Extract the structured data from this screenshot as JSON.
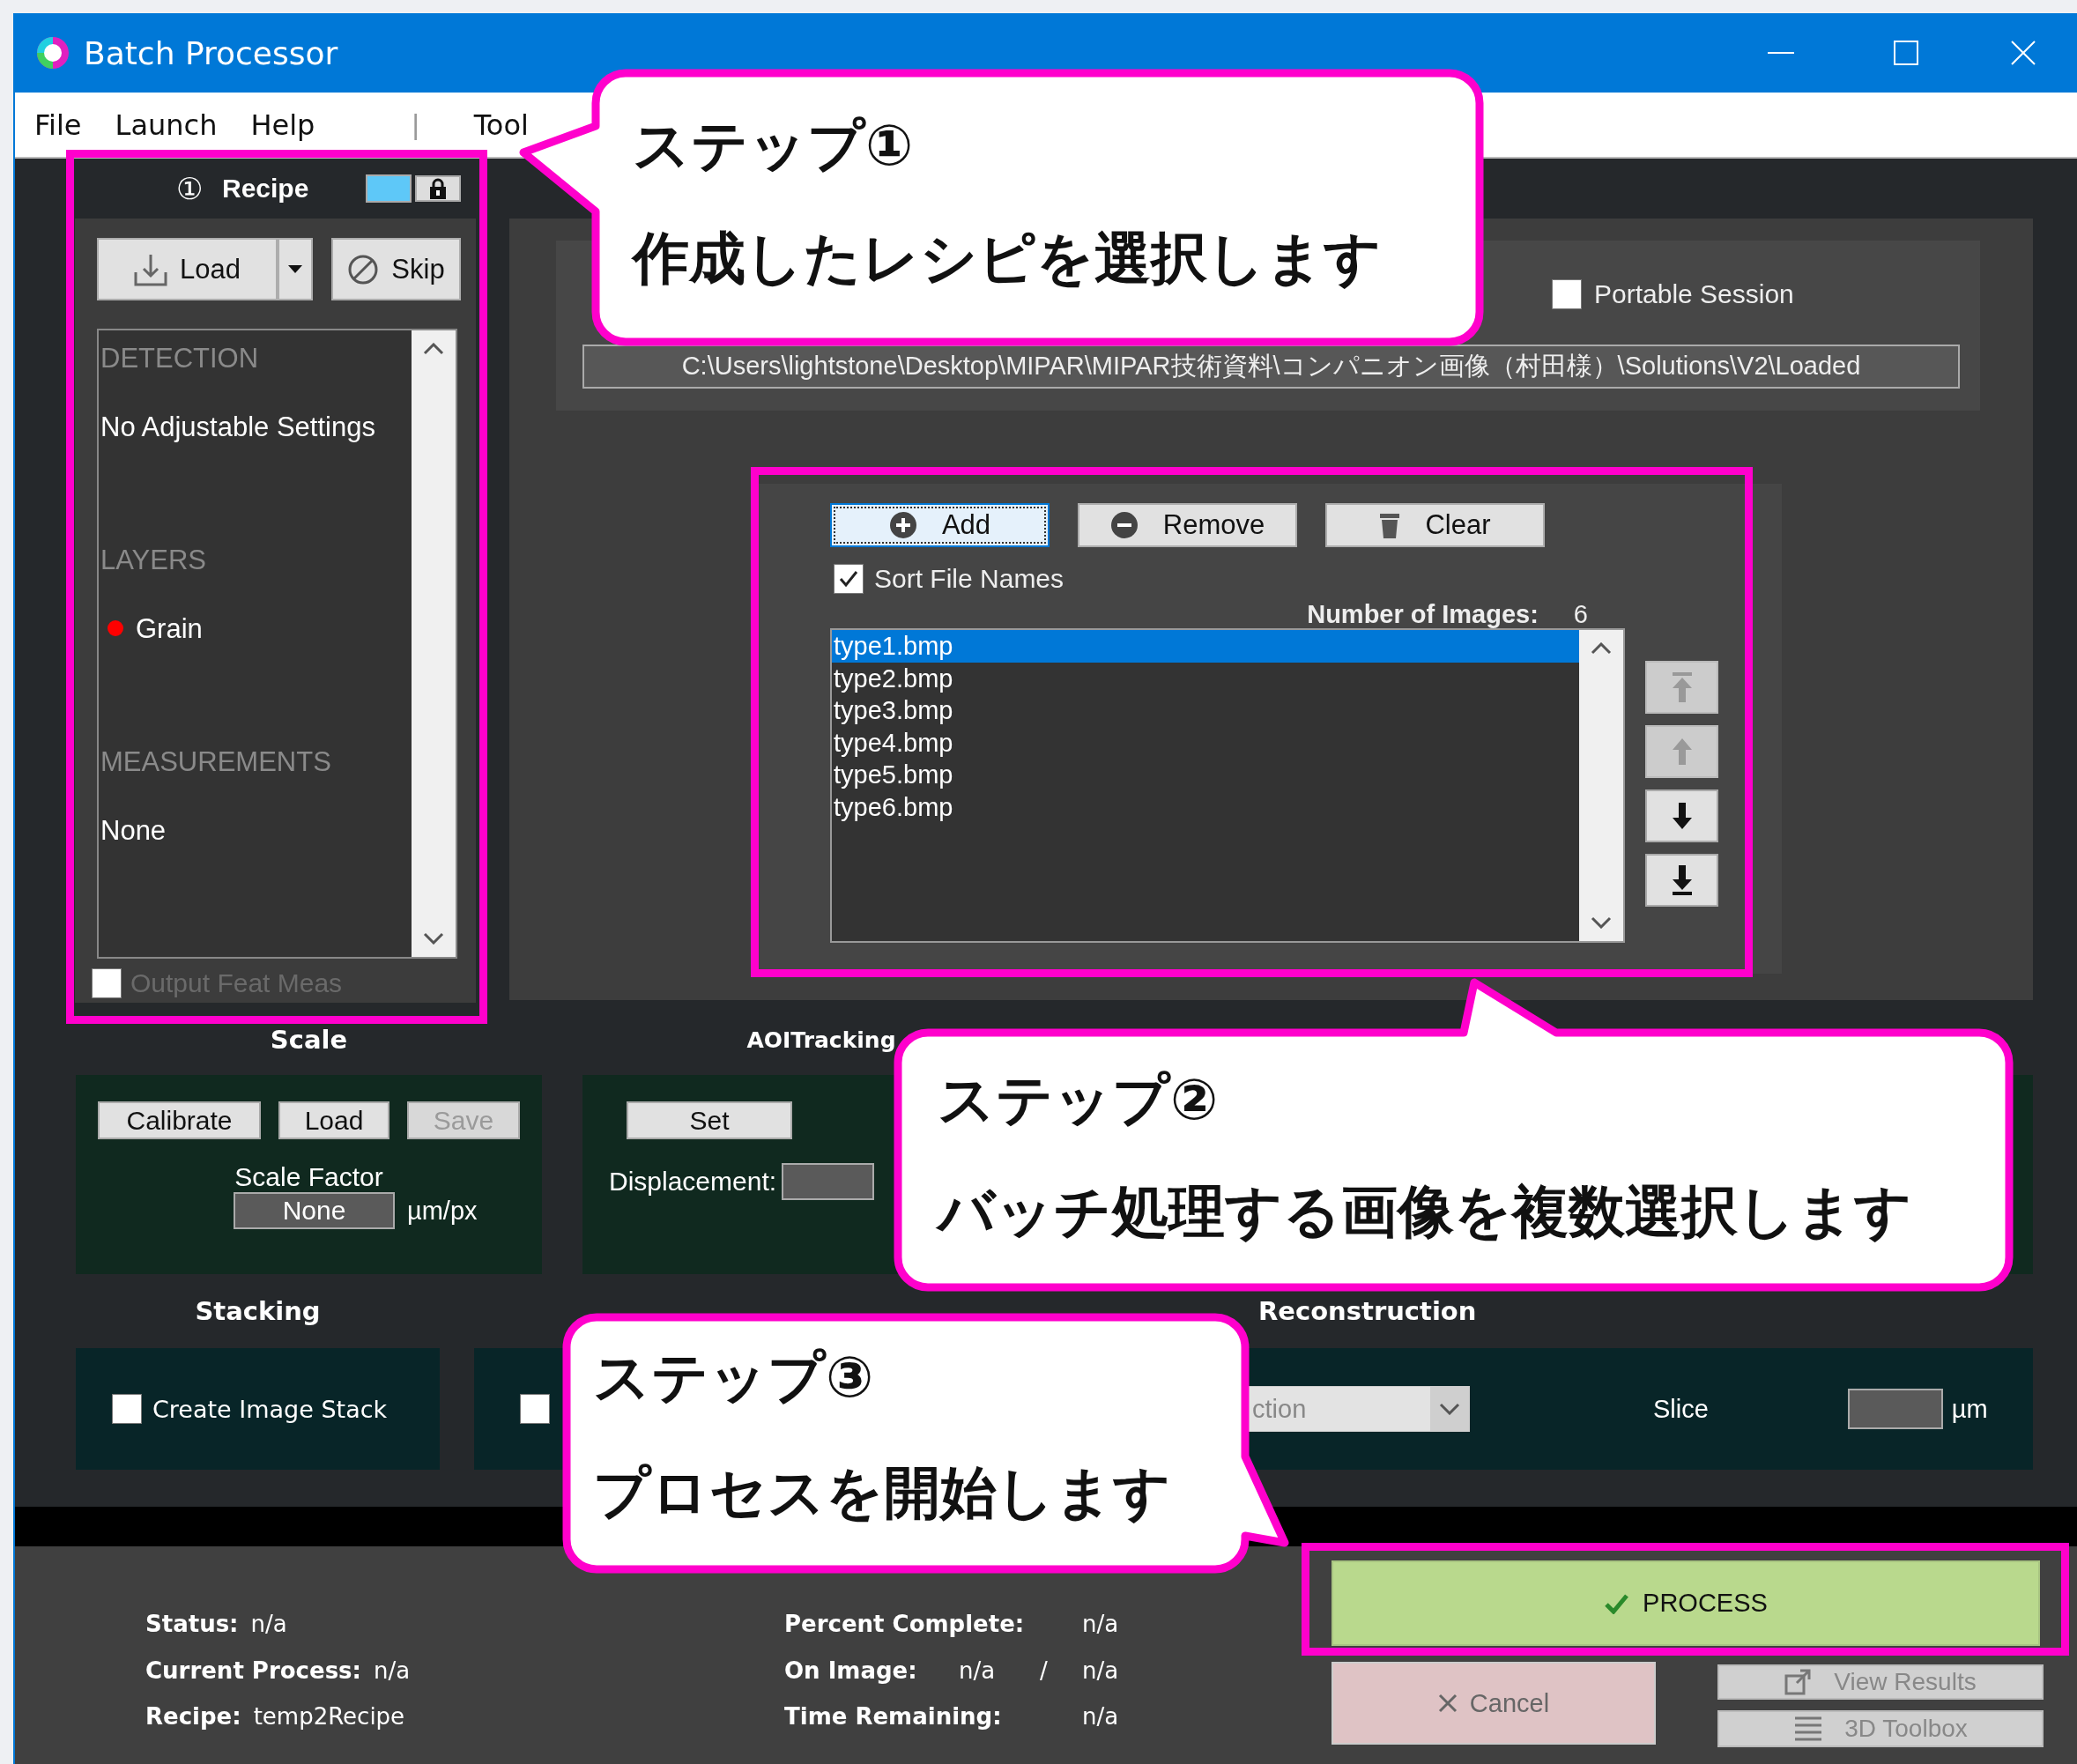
{
  "window": {
    "title": "Batch Processor"
  },
  "menu": [
    {
      "label": "File",
      "kind": "item"
    },
    {
      "label": "Launch",
      "kind": "item"
    },
    {
      "label": "Help",
      "kind": "item"
    },
    {
      "label": "|",
      "kind": "separator"
    },
    {
      "label": "Tool",
      "kind": "item"
    }
  ],
  "recipe": {
    "number": "①",
    "title": "Recipe",
    "load_button": "Load",
    "skip_button": "Skip",
    "sections": [
      {
        "heading": "DETECTION",
        "items": [
          {
            "label": "No Adjustable Settings"
          }
        ]
      },
      {
        "heading": "LAYERS",
        "items": [
          {
            "label": "Grain",
            "color": "#ff0000"
          }
        ]
      },
      {
        "heading": "MEASUREMENTS",
        "items": [
          {
            "label": "None"
          }
        ]
      }
    ],
    "output_feat_meas": {
      "label": "Output Feat Meas",
      "checked": false,
      "disabled": true
    }
  },
  "session": {
    "portable_session": {
      "label": "Portable Session",
      "checked": false
    },
    "path": "C:\\Users\\lightstone\\Desktop\\MIPAR\\MIPAR技術資料\\コンパニオン画像（村田様）\\Solutions\\V2\\Loaded"
  },
  "files": {
    "buttons": [
      {
        "label": "Add",
        "kind": "add",
        "focused": true
      },
      {
        "label": "Remove",
        "kind": "remove",
        "focused": false
      },
      {
        "label": "Clear",
        "kind": "clear",
        "focused": false
      }
    ],
    "sort_file_names": {
      "label": "Sort File Names",
      "checked": true
    },
    "count_label": "Number of Images:",
    "count": "6",
    "items": [
      {
        "name": "type1.bmp",
        "selected": true
      },
      {
        "name": "type2.bmp",
        "selected": false
      },
      {
        "name": "type3.bmp",
        "selected": false
      },
      {
        "name": "type4.bmp",
        "selected": false
      },
      {
        "name": "type5.bmp",
        "selected": false
      },
      {
        "name": "type6.bmp",
        "selected": false
      }
    ],
    "move_buttons": [
      {
        "kind": "top",
        "disabled": true
      },
      {
        "kind": "up",
        "disabled": true
      },
      {
        "kind": "down",
        "disabled": false
      },
      {
        "kind": "bottom",
        "disabled": false
      }
    ]
  },
  "scale": {
    "title": "Scale",
    "buttons": [
      {
        "label": "Calibrate",
        "disabled": false
      },
      {
        "label": "Load",
        "disabled": false
      },
      {
        "label": "Save",
        "disabled": true
      }
    ],
    "factor_label": "Scale Factor",
    "factor_value": "None",
    "unit": "µm/px"
  },
  "aoi_tracking": {
    "title": "AOITracking",
    "set_button": "Set",
    "displacement_label": "Displacement:"
  },
  "stacking": {
    "title": "Stacking",
    "create_image_stack": {
      "label": "Create Image Stack",
      "checked": false
    }
  },
  "reconstruction": {
    "title": "Reconstruction",
    "checked": false,
    "method_value": "ction",
    "slice_label": "Slice",
    "slice_unit": "µm"
  },
  "status": {
    "rows": [
      {
        "label": "Status:",
        "value": "n/a"
      },
      {
        "label": "Current Process:",
        "value": "n/a"
      },
      {
        "label": "Recipe:",
        "value": "temp2Recipe"
      }
    ],
    "progress": [
      {
        "label": "Percent Complete:",
        "value": "n/a"
      },
      {
        "label": "On Image:",
        "value": "n/a",
        "separator": "/",
        "total": "n/a"
      },
      {
        "label": "Time Remaining:",
        "value": "n/a"
      }
    ]
  },
  "actions": {
    "process": "PROCESS",
    "cancel": "Cancel",
    "view_results": "View Results",
    "toolbox": "3D Toolbox"
  },
  "callouts": [
    {
      "title": "ステップ①",
      "text": "作成したレシピを選択します"
    },
    {
      "title": "ステップ②",
      "text": "バッチ処理する画像を複数選択します"
    },
    {
      "title": "ステップ③",
      "text": "プロセスを開始します"
    }
  ]
}
